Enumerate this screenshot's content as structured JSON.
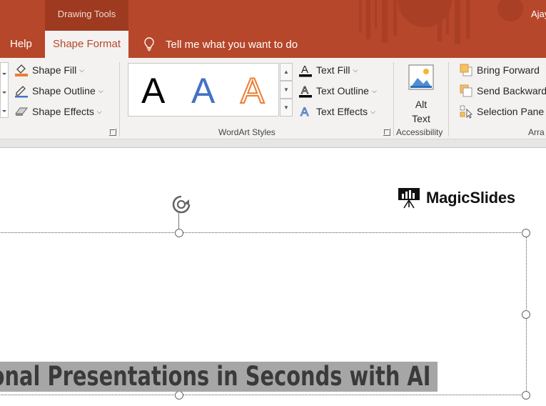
{
  "title_bar": {
    "contextual_group": "Drawing Tools",
    "user_name": "Ajay",
    "tabs": [
      {
        "label": "Help",
        "active": false
      },
      {
        "label": "Shape Format",
        "active": true
      }
    ],
    "tell_me": "Tell me what you want to do"
  },
  "ribbon": {
    "shape_styles": {
      "shape_fill": "Shape Fill",
      "shape_outline": "Shape Outline",
      "shape_effects": "Shape Effects"
    },
    "wordart_styles": {
      "label": "WordArt Styles",
      "gallery": [
        "A",
        "A",
        "A"
      ],
      "text_fill": "Text Fill",
      "text_outline": "Text Outline",
      "text_effects": "Text Effects"
    },
    "accessibility": {
      "label": "Accessibility",
      "alt_text_line1": "Alt",
      "alt_text_line2": "Text"
    },
    "arrange": {
      "label": "Arra",
      "bring_forward": "Bring Forward",
      "send_backward": "Send Backward",
      "selection_pane": "Selection Pane"
    }
  },
  "slide": {
    "logo_text": "MagicSlides",
    "headline": "Professional Presentations in Seconds with AI"
  },
  "colors": {
    "accent": "#b7472a",
    "ribbon_bg": "#f3f2f1",
    "wordart_blue": "#4472c4",
    "wordart_orange": "#ed7d31"
  }
}
